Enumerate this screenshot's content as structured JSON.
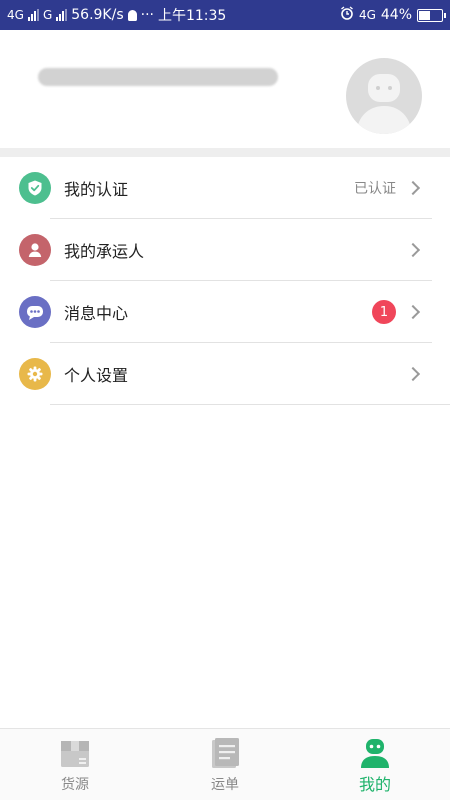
{
  "status_bar": {
    "network_1": "4G",
    "network_2": "G",
    "speed": "56.9K/s",
    "more": "···",
    "time": "上午11:35",
    "network_3": "4G",
    "battery": "44%"
  },
  "menu": {
    "items": [
      {
        "label": "我的认证",
        "value": "已认证",
        "icon": "shield-check-icon",
        "color": "#4dbf8f"
      },
      {
        "label": "我的承运人",
        "icon": "person-icon",
        "color": "#c4646b"
      },
      {
        "label": "消息中心",
        "badge": "1",
        "icon": "chat-bubble-icon",
        "color": "#6a6fc4"
      },
      {
        "label": "个人设置",
        "icon": "gear-icon",
        "color": "#e8b84a"
      }
    ]
  },
  "tabbar": {
    "tabs": [
      {
        "label": "货源",
        "icon": "box-icon"
      },
      {
        "label": "运单",
        "icon": "document-icon"
      },
      {
        "label": "我的",
        "icon": "robot-avatar-icon"
      }
    ],
    "active_index": 2,
    "active_color": "#1fb36b",
    "inactive_color": "#888888"
  }
}
